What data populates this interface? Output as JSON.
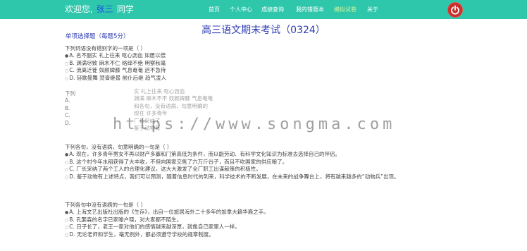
{
  "header": {
    "welcome_prefix": "欢迎您,",
    "username": "张三",
    "welcome_suffix": "同学",
    "nav": [
      "首页",
      "个人中心",
      "成绩查询",
      "我的错题本",
      "模拟试卷",
      "关于"
    ],
    "active_nav": "模拟试卷",
    "logout_icon": "power-icon",
    "colors": {
      "bar": "#2ec7ac",
      "username": "#1f4fe0",
      "logout": "#c9302c"
    }
  },
  "exam": {
    "title": "高三语文期末考试（0324）",
    "section_title": "单项选择题（每题5分）"
  },
  "questions": [
    {
      "stem": "下列词语没有错别字的一项是（ ）",
      "options": [
        {
          "key": "A",
          "text": "名不副实 礼上往来 呕心沥血 如愿以偿",
          "selected": true
        },
        {
          "key": "B",
          "text": "渊满尽致 麻木不仁 络绎不绝 明察秋毫",
          "selected": false
        },
        {
          "key": "C",
          "text": "流离迁徙 奴颜婢膝 气息奄奄 迫不急待",
          "selected": false
        },
        {
          "key": "D",
          "text": "轻歌曼舞 焚膏继晷 前仆后继 趋气凌人",
          "selected": false
        }
      ]
    },
    {
      "stem": "下列各句，没有语病，句意明确的一句是（ ）",
      "options": [
        {
          "key": "A",
          "text": "现在，许多青年男女不再以财产多寡和门第高低为条件，而以能劳动、有科学文化知识为标准去选择自己的伴侣。",
          "selected": true
        },
        {
          "key": "B",
          "text": "这个村今年水稻获得了大丰收，不但向国家交售了六万斤谷子，而且不吃国家的供应粮了。",
          "selected": false
        },
        {
          "key": "C",
          "text": "厂长采纳了两个工人的合理化建议，这大大激发了全厂职工出谋献策的积极性。",
          "selected": false
        },
        {
          "key": "D",
          "text": "鉴于动物有上述特点，我们可以预测，随着信息时代的到来，科学技术的不断发展，在未来的战争舞台上，将有越来越多的“动物兵”出现。",
          "selected": false
        }
      ]
    },
    {
      "stem": "下列各句中没有语病的一句是（ ）",
      "options": [
        {
          "key": "A",
          "text": "上海文艺出版社出版的《生存》，出自一位旅居海外二十多年的加拿大籍华裔之手。",
          "selected": true
        },
        {
          "key": "B",
          "text": "孔繁森的名字已家喻户晓，对大家都不陌生。",
          "selected": false
        },
        {
          "key": "C",
          "text": "日子长了，老王一家对他们的感情越来越深厚，就像自己家里人一样。",
          "selected": false
        },
        {
          "key": "D",
          "text": "无论老师和学生，毫无例外，都必须遵守学校的规章制度。",
          "selected": false
        }
      ]
    }
  ],
  "overlap_fragments": {
    "left": [
      "下列",
      "A.",
      "B.",
      "C.",
      "D."
    ],
    "middle": [
      "实 礼上往来 呕心沥血",
      "渊满 麻木不不 奴颜婢膝 气息奄奄",
      "和各句，没有语病，句意明确的",
      "现在 许多青年",
      "厂长采纳了",
      "鉴于动物有"
    ]
  },
  "watermark": "https://www.songma.com"
}
